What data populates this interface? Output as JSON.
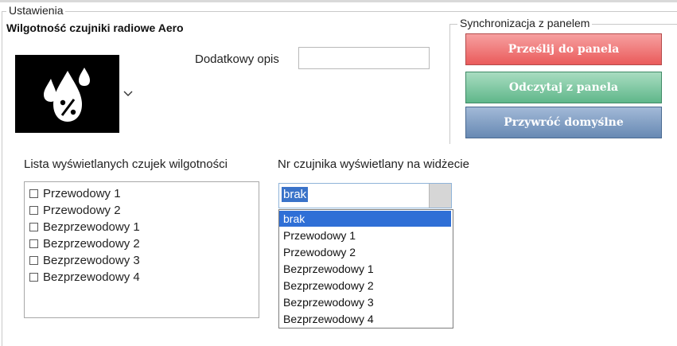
{
  "settings_group": {
    "title": "Ustawienia",
    "section_title": "Wilgotność czujniki radiowe Aero"
  },
  "icon_picker": {
    "icon": "humidity-drops-percent-icon"
  },
  "description": {
    "label": "Dodatkowy opis",
    "value": ""
  },
  "sync_group": {
    "title": "Synchronizacja z panelem",
    "send_label": "Prześlij do panela",
    "read_label": "Odczytaj z panela",
    "reset_label": "Przywróć domyślne"
  },
  "sensor_list": {
    "label": "Lista wyświetlanych czujek wilgotności",
    "items": [
      "Przewodowy 1",
      "Przewodowy 2",
      "Bezprzewodowy 1",
      "Bezprzewodowy 2",
      "Bezprzewodowy 3",
      "Bezprzewodowy 4"
    ]
  },
  "widget_sensor": {
    "label": "Nr czujnika wyświetlany na widżecie",
    "selected": "brak",
    "options": [
      "brak",
      "Przewodowy 1",
      "Przewodowy 2",
      "Bezprzewodowy 1",
      "Bezprzewodowy 2",
      "Bezprzewodowy 3",
      "Bezprzewodowy 4"
    ]
  }
}
